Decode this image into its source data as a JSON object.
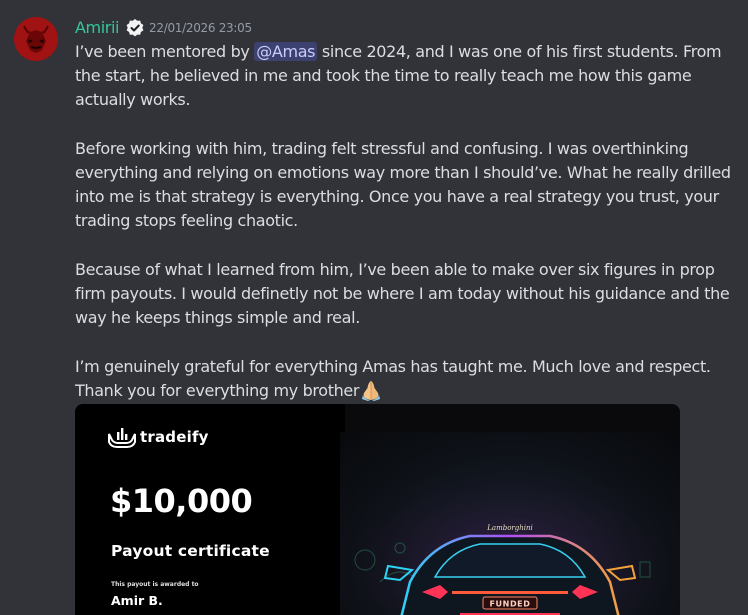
{
  "message": {
    "author": "Amirii",
    "timestamp": "22/01/2026 23:05",
    "paragraphs": [
      {
        "before_mention": "I’ve been mentored by ",
        "mention": "@Amas",
        "after_mention": " since 2024, and I was one of his first students. From the start, he believed in me and took the time to really teach me how this game actually works."
      },
      {
        "text": "Before working with him, trading felt stressful and confusing. I was overthinking everything and relying on emotions way more than I should’ve. What he really drilled into me is that strategy is everything. Once you have a real strategy you trust, your trading stops feeling chaotic."
      },
      {
        "text": "Because of what I learned from him, I’ve been able to make over six figures in prop firm payouts. I would definetly not be where I am today without his guidance and the way he keeps things simple and real."
      },
      {
        "text": "I’m genuinely grateful for everything Amas has taught me. Much love and respect. Thank you for everything my brother",
        "trailing_emoji": "folded-hands-emoji"
      }
    ]
  },
  "attachment": {
    "brand": "tradeify",
    "amount": "$10,000",
    "title": "Payout certificate",
    "awarded_label": "This payout is awarded to",
    "recipient": "Amir B.",
    "car_plate": "FUNDED",
    "car_script": "Lamborghini"
  },
  "icons": {
    "verified": "verified-check-icon",
    "avatar": "red-demon-avatar",
    "brand_logo": "hands-chart-logo-icon"
  },
  "colors": {
    "background": "#323339",
    "username": "#34c69a",
    "timestamp": "#949ba4",
    "text": "#dbdee1",
    "mention_bg": "#4c5290",
    "mention_text": "#c9cdfb"
  }
}
